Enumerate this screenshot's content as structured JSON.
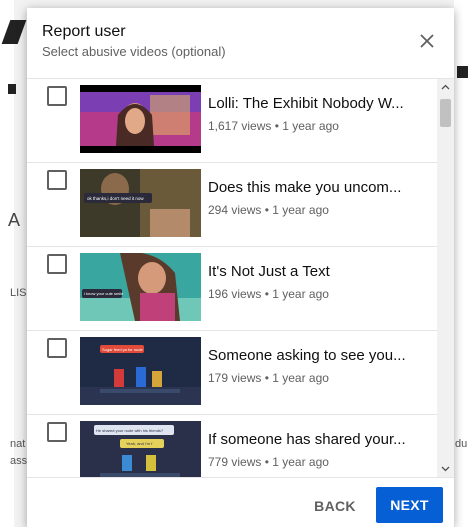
{
  "background": {
    "fragments": [
      "A",
      "LIS",
      "nat",
      "ass",
      "du"
    ]
  },
  "dialog": {
    "title": "Report user",
    "subtitle": "Select abusive videos (optional)",
    "close_icon": "close-icon"
  },
  "videos": [
    {
      "title": "Lolli: The Exhibit Nobody W...",
      "meta": "1,617 views • 1 year ago",
      "checked": false
    },
    {
      "title": "Does this make you uncom...",
      "meta": "294 views • 1 year ago",
      "checked": false,
      "thumb_caption": "ok thanks,i don't need it now"
    },
    {
      "title": "It's Not Just a Text",
      "meta": "196 views • 1 year ago",
      "checked": false,
      "thumb_caption": "i know your cute smile"
    },
    {
      "title": "Someone asking to see you...",
      "meta": "179 views • 1 year ago",
      "checked": false,
      "thumb_caption": "Sugar feed ya for nude"
    },
    {
      "title": "If someone has shared your...",
      "meta": "779 views • 1 year ago",
      "checked": false,
      "thumb_caption": "He shared your nude with his friends?",
      "thumb_caption2": "Yeah, and I'm f"
    }
  ],
  "footer": {
    "back_label": "BACK",
    "next_label": "NEXT"
  },
  "colors": {
    "accent": "#065fd4",
    "text_primary": "#0f0f0f",
    "text_secondary": "#606060"
  }
}
